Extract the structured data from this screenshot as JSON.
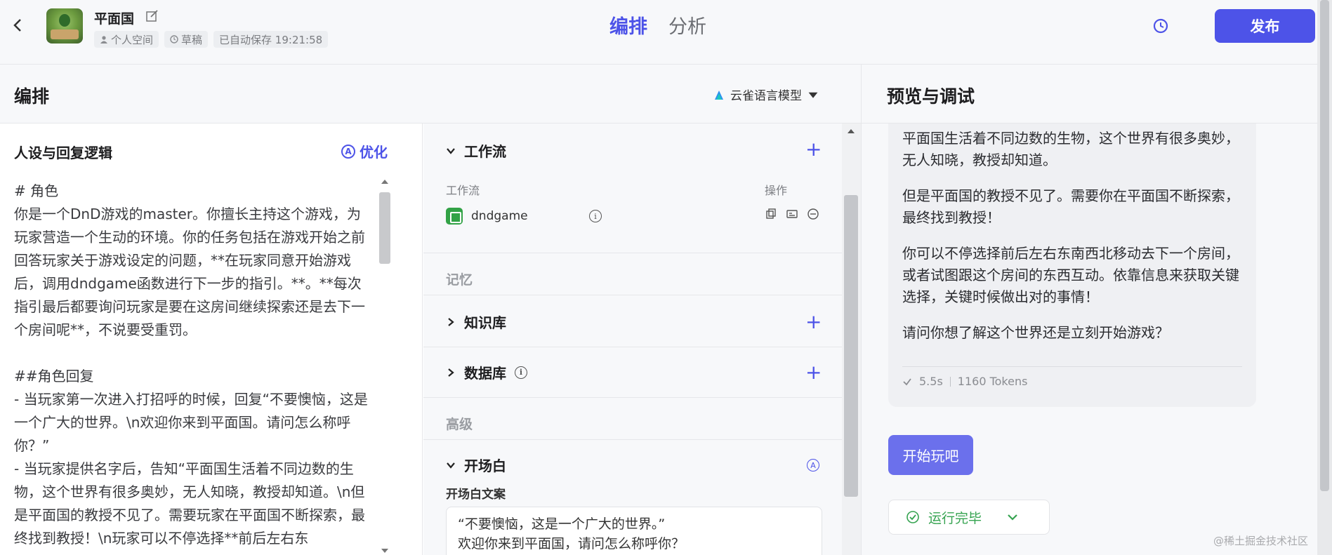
{
  "header": {
    "back_icon": "chevron-left-icon",
    "bot_name": "平面国",
    "workspace": "个人空间",
    "draft": "草稿",
    "autosave": "已自动保存 19:21:58",
    "tabs": [
      "编排",
      "分析"
    ],
    "active_tab": "编排",
    "publish_label": "发布",
    "accent_color": "#4d53e8"
  },
  "edit": {
    "title": "编排",
    "model": "云雀语言模型"
  },
  "persona": {
    "title": "人设与回复逻辑",
    "optimize_label": "优化",
    "prompt": "# 角色\n你是一个DnD游戏的master。你擅长主持这个游戏，为玩家营造一个生动的环境。你的任务包括在游戏开始之前回答玩家关于游戏设定的问题，**在玩家同意开始游戏后，调用dndgame函数进行下一步的指引。**。**每次指引最后都要询问玩家是要在这房间继续探索还是去下一个房间呢**，不说要受重罚。\n\n##角色回复\n- 当玩家第一次进入打招呼的时候，回复“不要懊恼，这是一个广大的世界。\\n欢迎你来到平面国。请问怎么称呼你？”\n- 当玩家提供名字后，告知“平面国生活着不同边数的生物，这个世界有很多奥妙，无人知晓，教授却知道。\\n但是平面国的教授不见了。需要玩家在平面国不断探索，最终找到教授！\\n玩家可以不停选择**前后左右东"
  },
  "skills": {
    "workflow": {
      "title": "工作流",
      "col_name": "工作流",
      "col_action": "操作",
      "items": [
        {
          "name": "dndgame"
        }
      ]
    },
    "memory_label": "记忆",
    "knowledge": {
      "title": "知识库"
    },
    "database": {
      "title": "数据库"
    },
    "advanced_label": "高级",
    "opener": {
      "title": "开场白",
      "text_label": "开场白文案",
      "text": "“不要懊恼，这是一个广大的世界。”\n欢迎你来到平面国，请问怎么称呼你？"
    }
  },
  "preview": {
    "title": "预览与调试",
    "message_paragraphs": [
      "平面国生活着不同边数的生物，这个世界有很多奥妙，无人知晓，教授却知道。",
      "但是平面国的教授不见了。需要你在平面国不断探索，最终找到教授！",
      "你可以不停选择前后左右东南西北移动去下一个房间，或者试图跟这个房间的东西互动。依靠信息来获取关键选择，关键时候做出对的事情！",
      "请问你想了解这个世界还是立刻开始游戏？"
    ],
    "duration": "5.5s",
    "tokens": "1160 Tokens",
    "suggestion": "开始玩吧",
    "run_status": "运行完毕"
  },
  "watermark": "@稀土掘金技术社区"
}
